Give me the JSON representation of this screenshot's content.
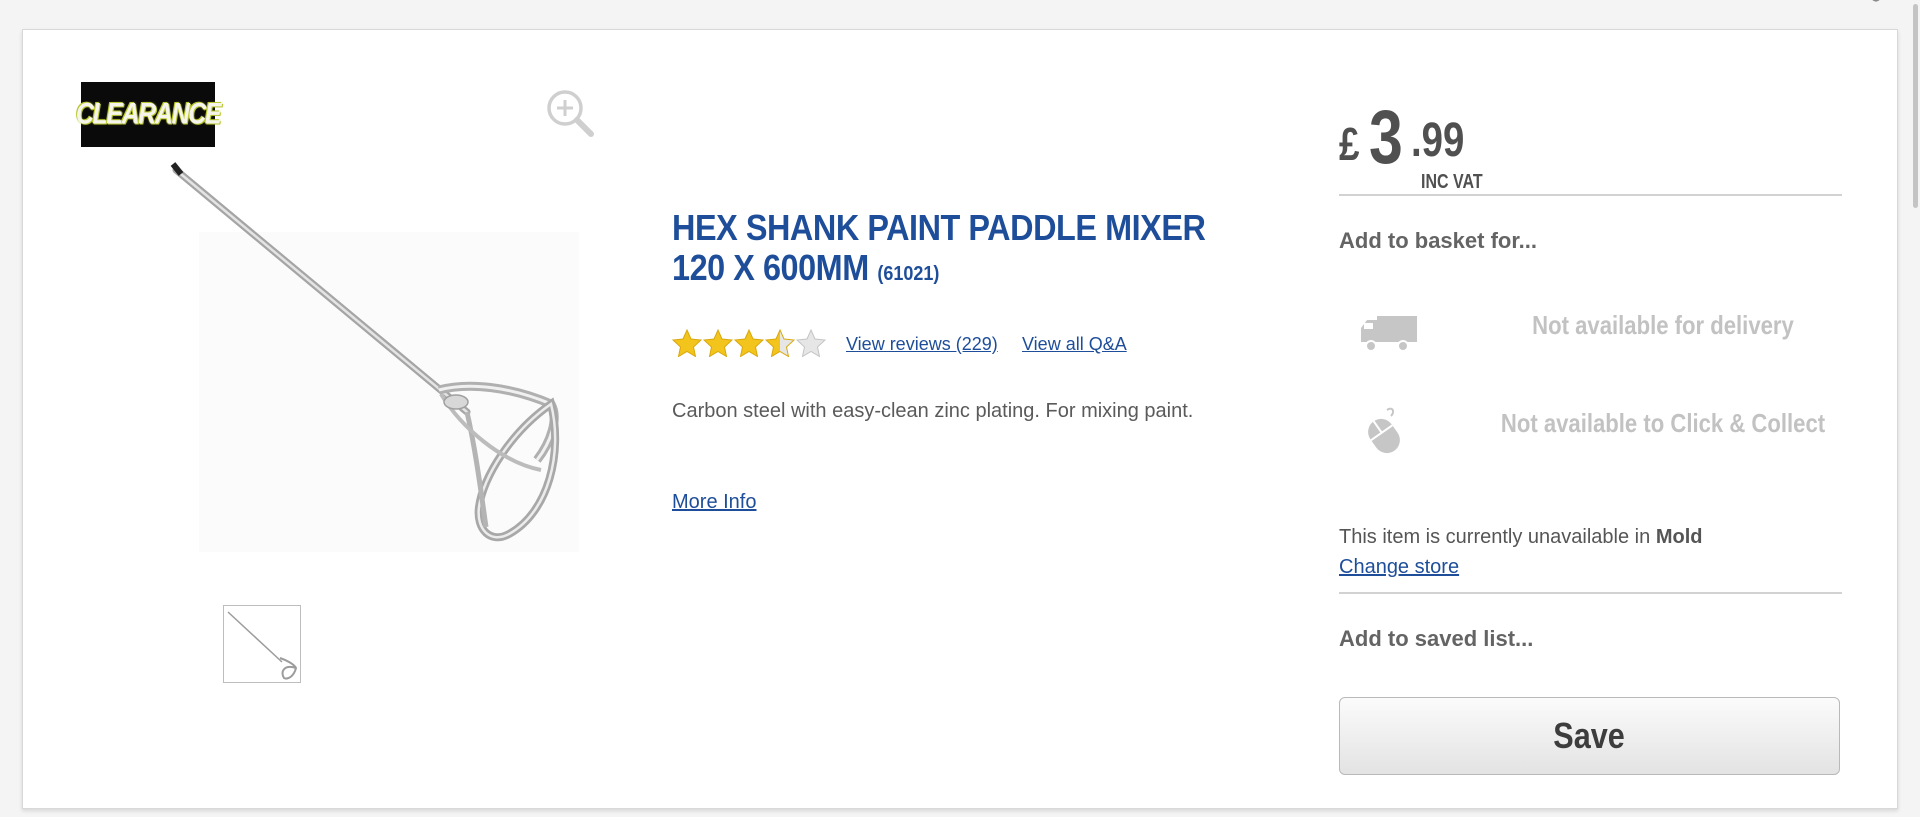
{
  "badge": {
    "text": "CLEARANCE"
  },
  "product": {
    "title": "HEX SHANK PAINT PADDLE MIXER 120 X 600MM",
    "code": "(61021)",
    "rating": 3.5,
    "rating_max": 5,
    "reviews_link": "View reviews (229)",
    "qa_link": "View all Q&A",
    "description": "Carbon steel with easy-clean zinc plating. For mixing paint.",
    "more_info_link": "More Info"
  },
  "price": {
    "currency": "£",
    "pounds": "3",
    "pence": ".99",
    "vat_label": "INC VAT"
  },
  "basket": {
    "heading": "Add to basket for...",
    "delivery": {
      "icon": "delivery-truck-icon",
      "text": "Not available for delivery"
    },
    "collect": {
      "icon": "mouse-click-icon",
      "text": "Not available to Click & Collect"
    },
    "store_message": "This item is currently unavailable in",
    "store_name": "Mold",
    "change_store_link": "Change store"
  },
  "saved_list": {
    "heading": "Add to saved list...",
    "save_label": "Save"
  },
  "icons": {
    "zoom": "zoom-in-icon",
    "star_color": "#f2c41c",
    "link_color": "#1e4e9a"
  }
}
